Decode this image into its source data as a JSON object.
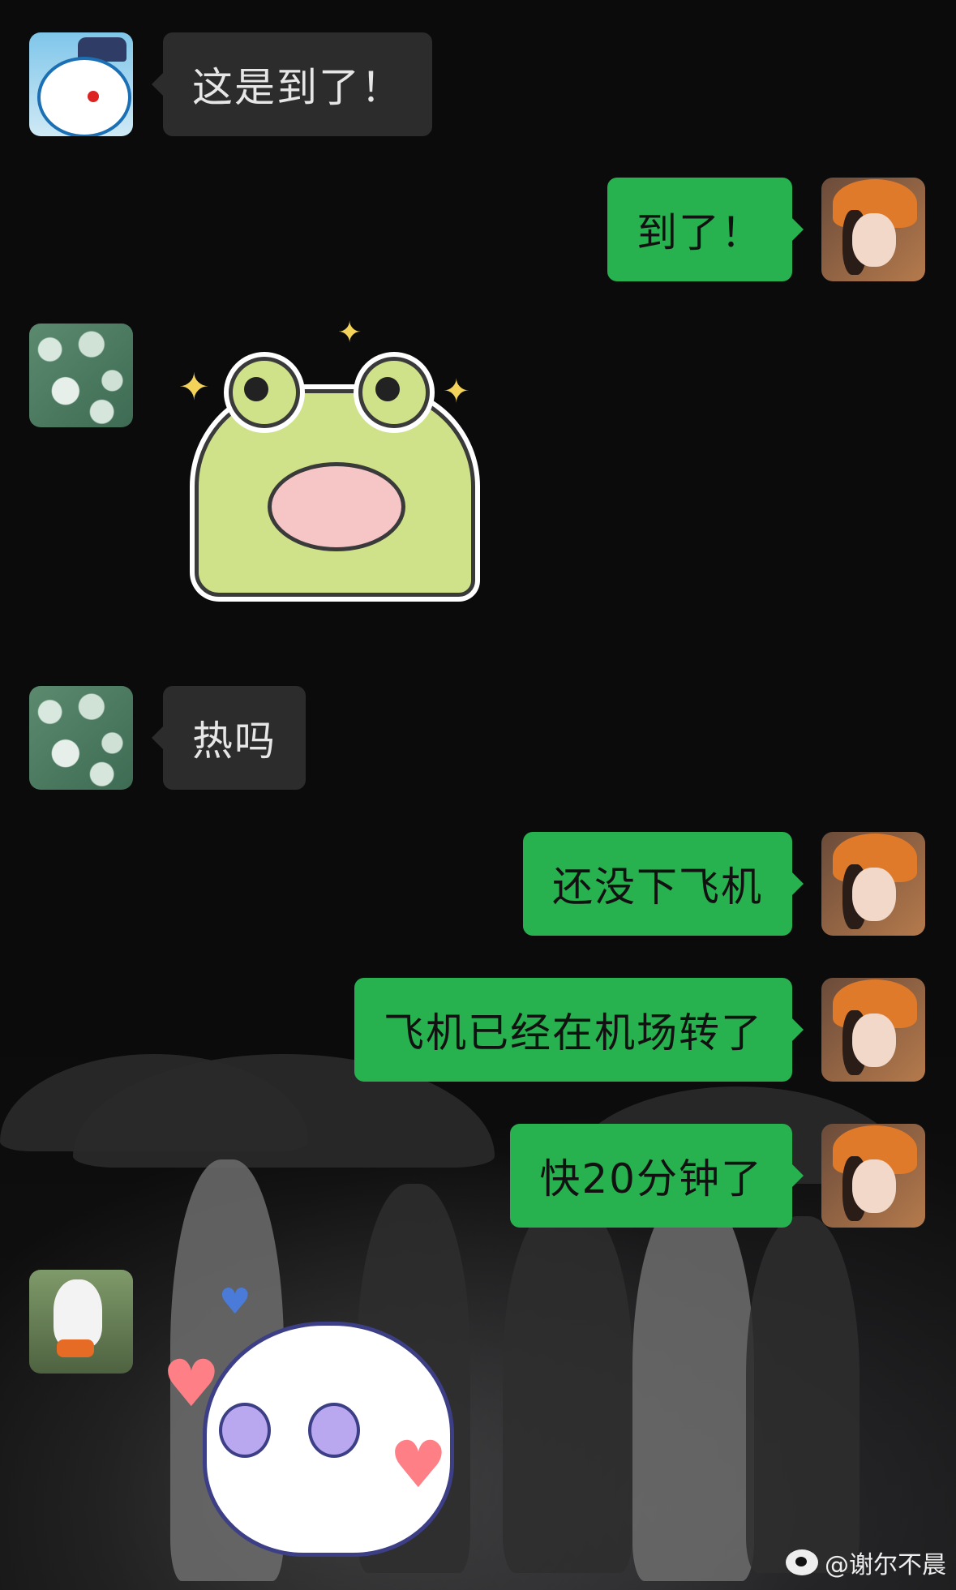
{
  "messages": [
    {
      "side": "in",
      "avatar": "doraemon-avatar",
      "text": "这是到了！"
    },
    {
      "side": "out",
      "avatar": "user-avatar",
      "text": "到了！"
    },
    {
      "side": "in",
      "avatar": "jellyfish-avatar",
      "sticker": "frog-sticker"
    },
    {
      "side": "in",
      "avatar": "jellyfish-avatar",
      "text": "热吗"
    },
    {
      "side": "out",
      "avatar": "user-avatar",
      "text": "还没下飞机"
    },
    {
      "side": "out",
      "avatar": "user-avatar",
      "text": "飞机已经在机场转了"
    },
    {
      "side": "out",
      "avatar": "user-avatar",
      "text": "快20分钟了"
    },
    {
      "side": "in",
      "avatar": "ghost-avatar",
      "sticker": "heart-ghost-sticker"
    }
  ],
  "watermark": {
    "text": "@谢尔不晨",
    "icon": "weibo-icon"
  }
}
